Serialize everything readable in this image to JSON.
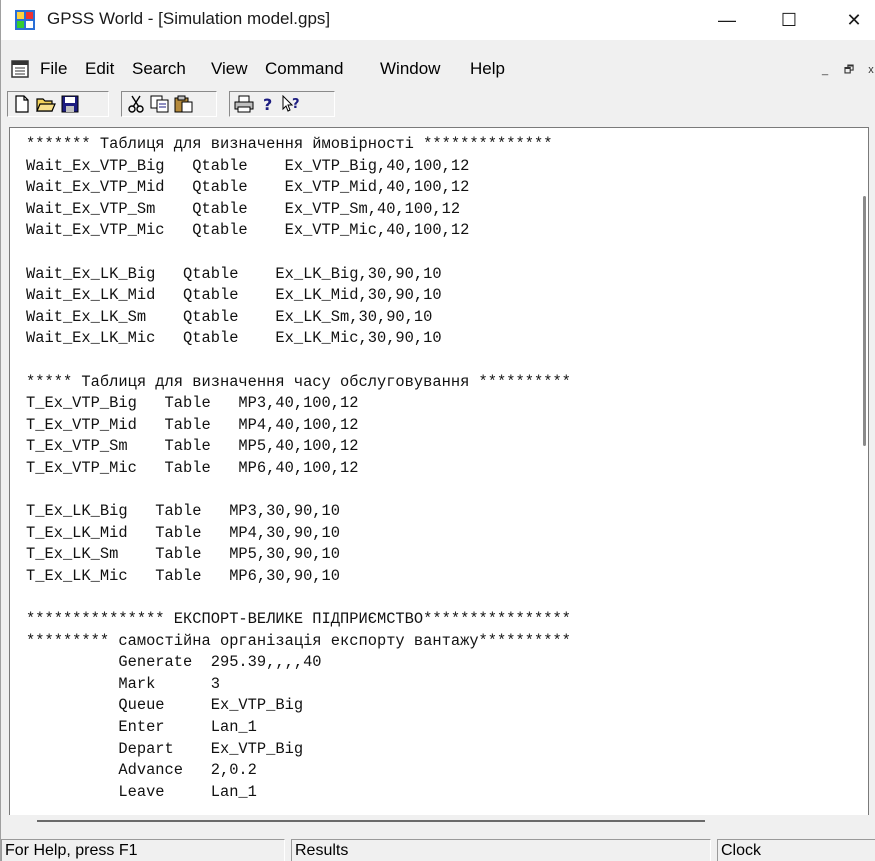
{
  "window": {
    "title": "GPSS World - [Simulation model.gps]",
    "icon": "gpss-app-icon",
    "controls": {
      "minimize": "—",
      "maximize": "☐",
      "close": "✕"
    }
  },
  "menubar": {
    "doc_icon": "document-icon",
    "items": [
      "File",
      "Edit",
      "Search",
      "View",
      "Command",
      "Window",
      "Help"
    ],
    "mdi_controls": {
      "minimize": "_",
      "restore": "🗗",
      "close": "x"
    }
  },
  "toolbar": {
    "buttons": [
      "new-icon",
      "open-icon",
      "save-icon",
      "cut-icon",
      "copy-icon",
      "paste-icon",
      "print-icon",
      "help-icon",
      "context-help-icon"
    ]
  },
  "editor": {
    "lines": [
      "******* Таблиця для визначення ймовірності **************",
      "Wait_Ex_VTP_Big   Qtable    Ex_VTP_Big,40,100,12",
      "Wait_Ex_VTP_Mid   Qtable    Ex_VTP_Mid,40,100,12",
      "Wait_Ex_VTP_Sm    Qtable    Ex_VTP_Sm,40,100,12",
      "Wait_Ex_VTP_Mic   Qtable    Ex_VTP_Mic,40,100,12",
      "",
      "Wait_Ex_LK_Big   Qtable    Ex_LK_Big,30,90,10",
      "Wait_Ex_LK_Mid   Qtable    Ex_LK_Mid,30,90,10",
      "Wait_Ex_LK_Sm    Qtable    Ex_LK_Sm,30,90,10",
      "Wait_Ex_LK_Mic   Qtable    Ex_LK_Mic,30,90,10",
      "",
      "***** Таблиця для визначення часу обслуговування **********",
      "T_Ex_VTP_Big   Table   MP3,40,100,12",
      "T_Ex_VTP_Mid   Table   MP4,40,100,12",
      "T_Ex_VTP_Sm    Table   MP5,40,100,12",
      "T_Ex_VTP_Mic   Table   MP6,40,100,12",
      "",
      "T_Ex_LK_Big   Table   MP3,30,90,10",
      "T_Ex_LK_Mid   Table   MP4,30,90,10",
      "T_Ex_LK_Sm    Table   MP5,30,90,10",
      "T_Ex_LK_Mic   Table   MP6,30,90,10",
      "",
      "*************** ЕКСПОРТ-ВЕЛИКЕ ПІДПРИЄМСТВО****************",
      "********* самостійна організація експорту вантажу**********",
      "          Generate  295.39,,,,40",
      "          Mark      3",
      "          Queue     Ex_VTP_Big",
      "          Enter     Lan_1",
      "          Depart    Ex_VTP_Big",
      "          Advance   2,0.2",
      "          Leave     Lan_1"
    ]
  },
  "statusbar": {
    "help": "For Help, press F1",
    "results": "Results",
    "clock": "Clock"
  }
}
